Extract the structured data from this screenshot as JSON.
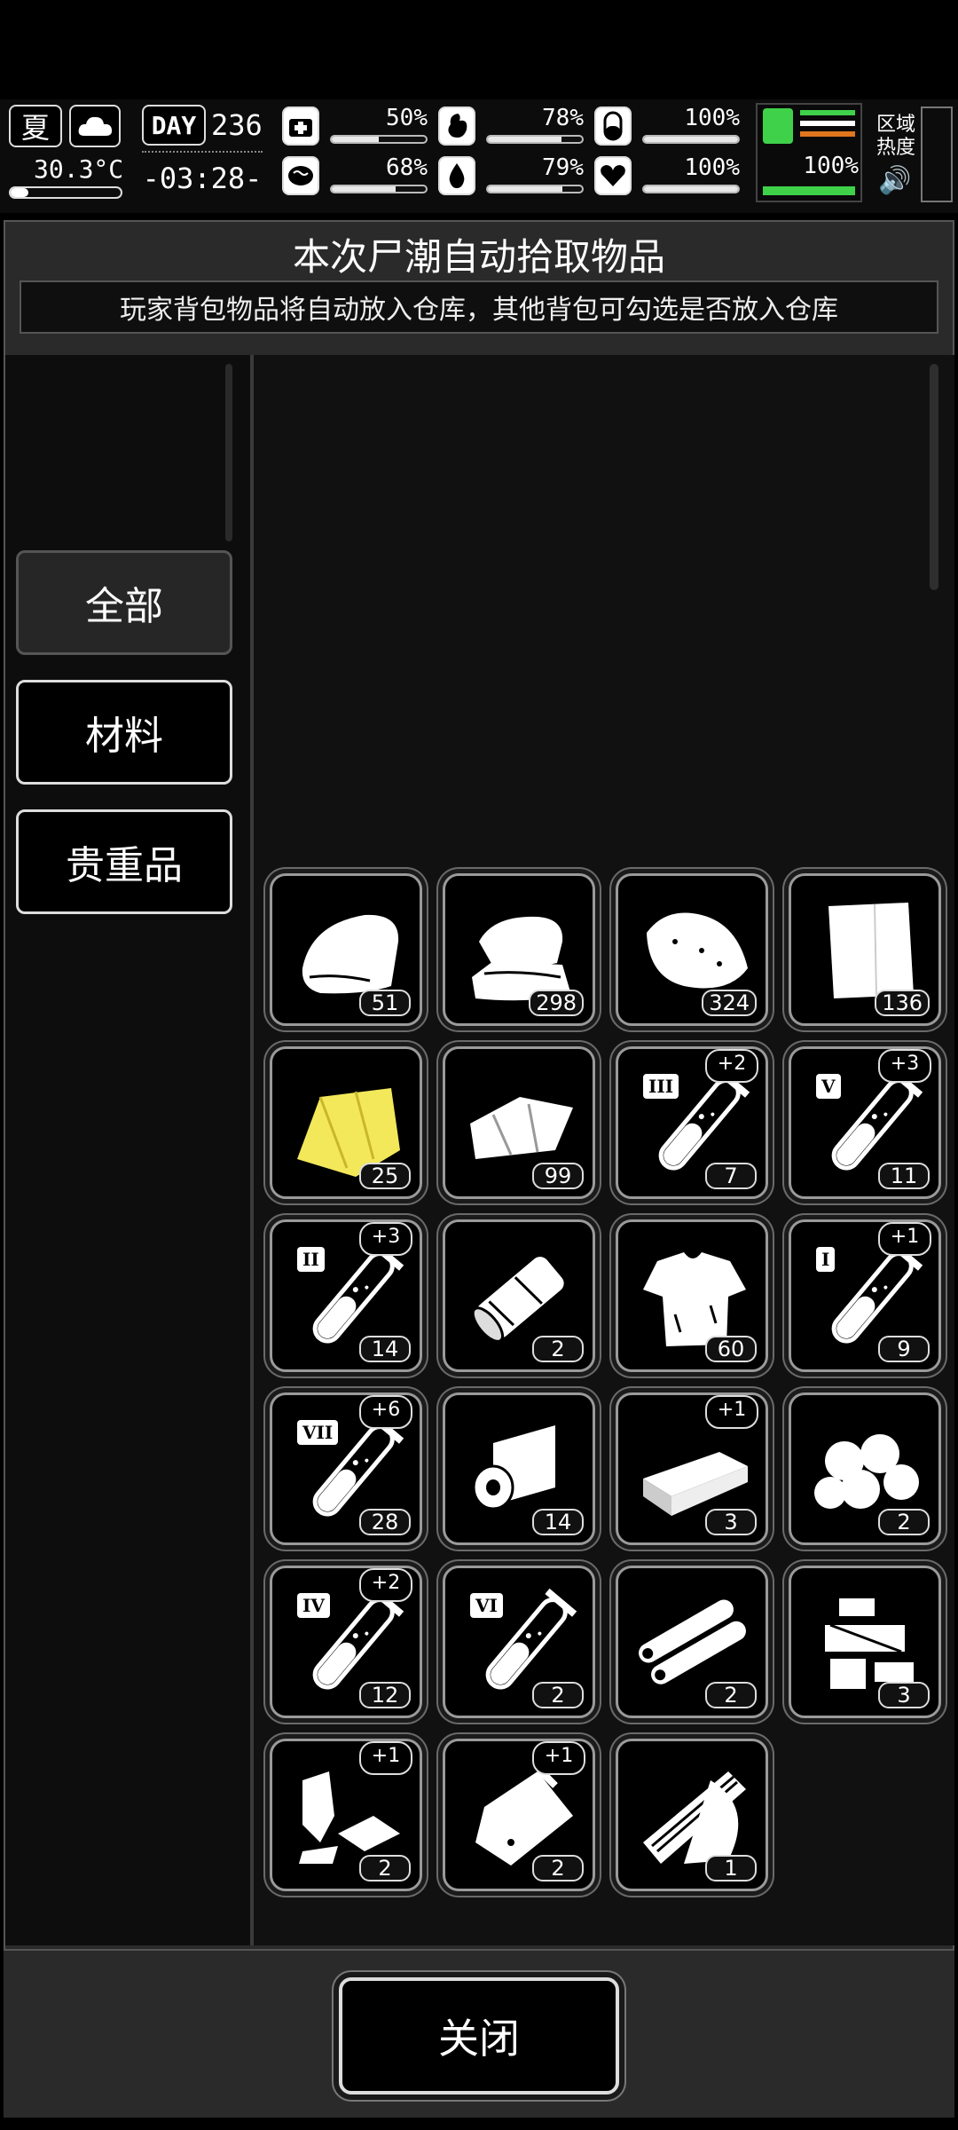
{
  "status": {
    "season": "夏",
    "temperature": "30.3°C",
    "day_label": "DAY",
    "day_number": "236",
    "clock": "-03:28-",
    "stats": [
      {
        "icon": "medkit-icon",
        "value": "50%",
        "fill": 0.5
      },
      {
        "icon": "stomach-icon",
        "value": "78%",
        "fill": 0.78
      },
      {
        "icon": "pill-icon",
        "value": "100%",
        "fill": 1.0
      },
      {
        "icon": "brain-icon",
        "value": "68%",
        "fill": 0.68
      },
      {
        "icon": "water-drop-icon",
        "value": "79%",
        "fill": 0.79
      },
      {
        "icon": "heart-icon",
        "value": "100%",
        "fill": 1.0
      }
    ],
    "stamina_value": "100%",
    "stamina_fill": 1.0,
    "area_heat_line1": "区域",
    "area_heat_line2": "热度"
  },
  "panel": {
    "title": "本次尸潮自动拾取物品",
    "subtitle": "玩家背包物品将自动放入仓库，其他背包可勾选是否放入仓库"
  },
  "tabs": [
    {
      "label": "全部",
      "active": true
    },
    {
      "label": "材料",
      "active": false
    },
    {
      "label": "贵重品",
      "active": false
    }
  ],
  "items": [
    {
      "icon": "cloth-icon",
      "count": "51",
      "plus": ""
    },
    {
      "icon": "folded-cloth-icon",
      "count": "298",
      "plus": ""
    },
    {
      "icon": "rag-bundle-icon",
      "count": "324",
      "plus": ""
    },
    {
      "icon": "paper-sheet-icon",
      "count": "136",
      "plus": ""
    },
    {
      "icon": "yellow-fabric-icon",
      "count": "25",
      "plus": ""
    },
    {
      "icon": "folded-fabric-icon",
      "count": "99",
      "plus": ""
    },
    {
      "icon": "test-tube-icon",
      "tier": "III",
      "count": "7",
      "plus": "+2"
    },
    {
      "icon": "test-tube-icon",
      "tier": "V",
      "count": "11",
      "plus": "+3"
    },
    {
      "icon": "test-tube-icon",
      "tier": "II",
      "count": "14",
      "plus": "+3"
    },
    {
      "icon": "rolled-fabric-icon",
      "count": "2",
      "plus": ""
    },
    {
      "icon": "torn-shirt-icon",
      "count": "60",
      "plus": ""
    },
    {
      "icon": "test-tube-icon",
      "tier": "I",
      "count": "9",
      "plus": "+1"
    },
    {
      "icon": "test-tube-icon",
      "tier": "VII",
      "count": "28",
      "plus": "+6"
    },
    {
      "icon": "tape-roll-icon",
      "count": "14",
      "plus": ""
    },
    {
      "icon": "board-icon",
      "count": "3",
      "plus": "+1"
    },
    {
      "icon": "cotton-balls-icon",
      "count": "2",
      "plus": ""
    },
    {
      "icon": "test-tube-icon",
      "tier": "IV",
      "count": "12",
      "plus": "+2"
    },
    {
      "icon": "test-tube-icon",
      "tier": "VI",
      "count": "2",
      "plus": ""
    },
    {
      "icon": "pipes-icon",
      "count": "2",
      "plus": ""
    },
    {
      "icon": "machine-parts-icon",
      "count": "3",
      "plus": ""
    },
    {
      "icon": "metal-scraps-icon",
      "count": "2",
      "plus": "+1"
    },
    {
      "icon": "pouch-icon",
      "count": "2",
      "plus": "+1"
    },
    {
      "icon": "wood-planks-icon",
      "count": "1",
      "plus": ""
    }
  ],
  "footer": {
    "close_label": "关闭"
  },
  "colors": {
    "panel_bg": "#2a2a2a",
    "grid_bg": "#111111",
    "stamina_green": "#3fd14a",
    "stamina_orange": "#e0761e",
    "yellow_fabric": "#f3e85a"
  }
}
